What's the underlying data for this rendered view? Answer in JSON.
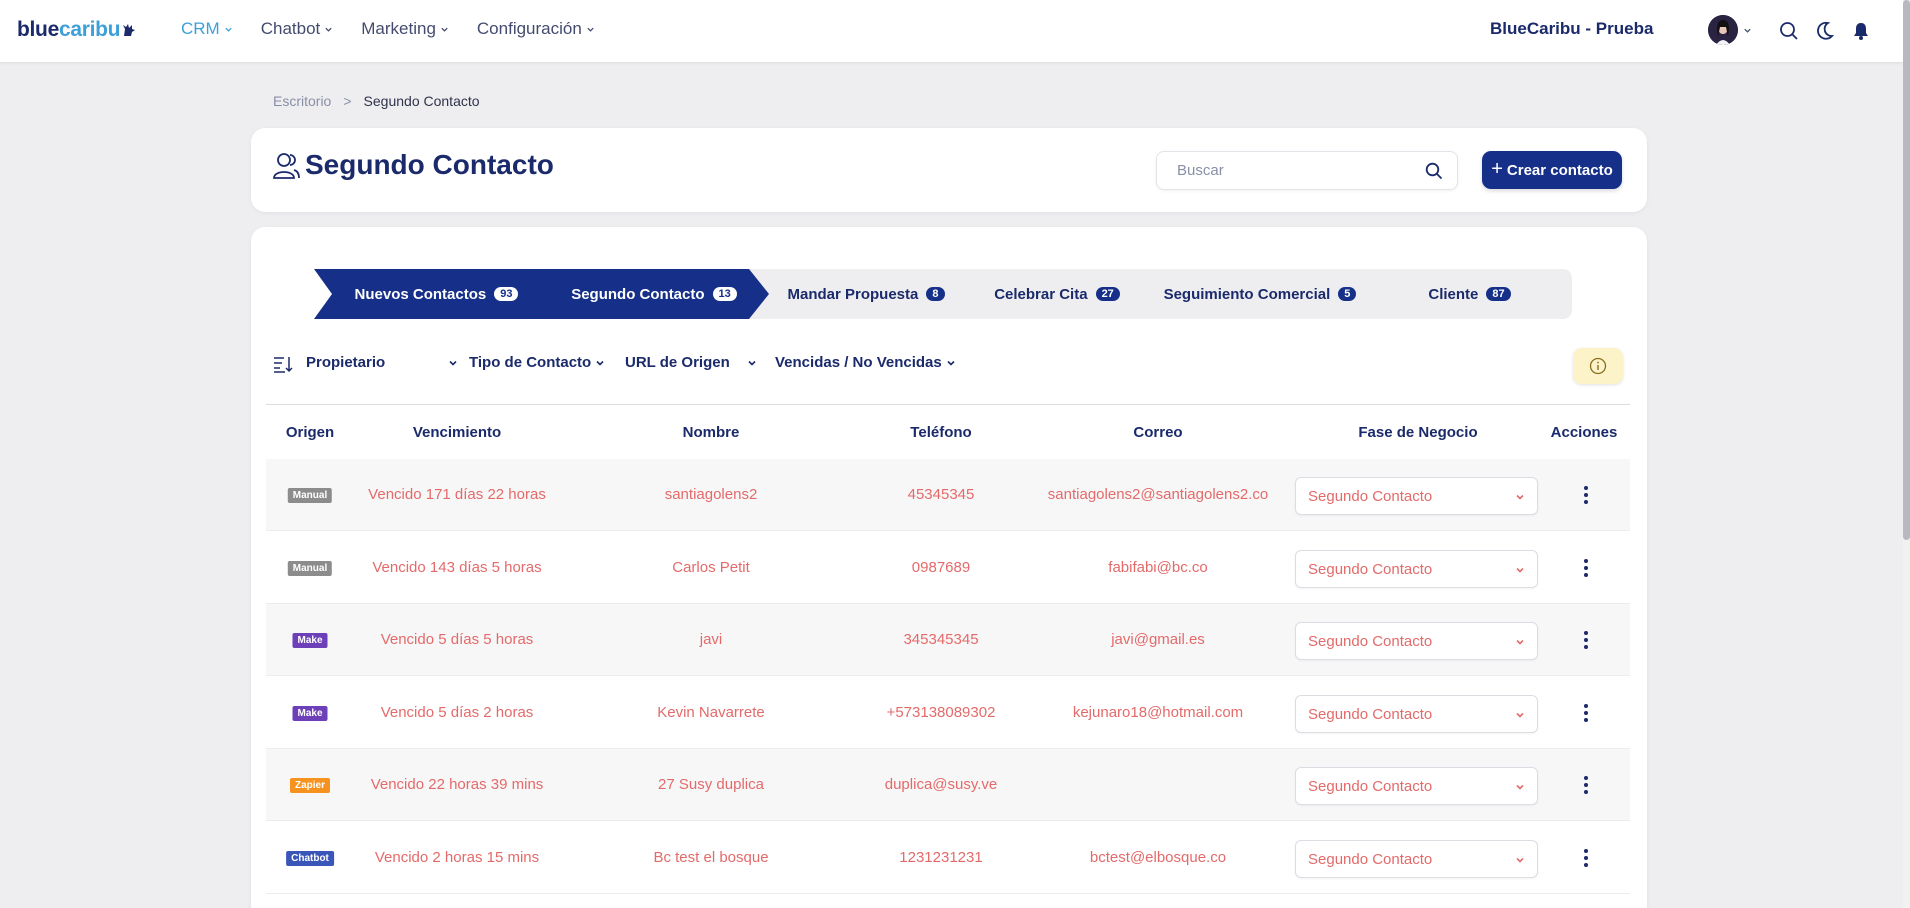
{
  "brand": {
    "logo_a": "blue",
    "logo_b": "caribu"
  },
  "nav": {
    "items": [
      {
        "label": "CRM",
        "active": true
      },
      {
        "label": "Chatbot",
        "active": false
      },
      {
        "label": "Marketing",
        "active": false
      },
      {
        "label": "Configuración",
        "active": false
      }
    ],
    "org_name": "BlueCaribu - Prueba"
  },
  "breadcrumb": {
    "root": "Escritorio",
    "separator": ">",
    "current": "Segundo Contacto"
  },
  "header": {
    "title": "Segundo Contacto",
    "search_placeholder": "Buscar",
    "create_label": "Crear contacto",
    "create_icon": "+"
  },
  "pipeline": [
    {
      "label": "Nuevos Contactos",
      "count": "93",
      "active": true
    },
    {
      "label": "Segundo Contacto",
      "count": "13",
      "active": true
    },
    {
      "label": "Mandar Propuesta",
      "count": "8",
      "active": false
    },
    {
      "label": "Celebrar Cita",
      "count": "27",
      "active": false
    },
    {
      "label": "Seguimiento Comercial",
      "count": "5",
      "active": false
    },
    {
      "label": "Cliente",
      "count": "87",
      "active": false
    }
  ],
  "filters": {
    "owner": "Propietario",
    "contact_type": "Tipo de Contacto",
    "origin_url": "URL de Origen",
    "expired": "Vencidas / No Vencidas"
  },
  "table": {
    "headers": {
      "origin": "Origen",
      "due": "Vencimiento",
      "name": "Nombre",
      "phone": "Teléfono",
      "email": "Correo",
      "stage": "Fase de Negocio",
      "actions": "Acciones"
    },
    "rows": [
      {
        "origin": "Manual",
        "origin_color": "#8c8c8c",
        "due": "Vencido 171 días 22 horas",
        "name": "santiagolens2",
        "phone": "45345345",
        "email": "santiagolens2@santiagolens2.co",
        "stage": "Segundo Contacto"
      },
      {
        "origin": "Manual",
        "origin_color": "#8c8c8c",
        "due": "Vencido 143 días 5 horas",
        "name": "Carlos Petit",
        "phone": "0987689",
        "email": "fabifabi@bc.co",
        "stage": "Segundo Contacto"
      },
      {
        "origin": "Make",
        "origin_color": "#6d3fb8",
        "due": "Vencido 5 días 5 horas",
        "name": "javi",
        "phone": "345345345",
        "email": "javi@gmail.es",
        "stage": "Segundo Contacto"
      },
      {
        "origin": "Make",
        "origin_color": "#6d3fb8",
        "due": "Vencido 5 días 2 horas",
        "name": "Kevin Navarrete",
        "phone": "+573138089302",
        "email": "kejunaro18@hotmail.com",
        "stage": "Segundo Contacto"
      },
      {
        "origin": "Zapier",
        "origin_color": "#f5931e",
        "due": "Vencido 22 horas 39 mins",
        "name": "27 Susy duplica",
        "phone": "duplica@susy.ve",
        "email": "",
        "stage": "Segundo Contacto"
      },
      {
        "origin": "Chatbot",
        "origin_color": "#3a56b8",
        "due": "Vencido 2 horas 15 mins",
        "name": "Bc test el bosque",
        "phone": "1231231231",
        "email": "bctest@elbosque.co",
        "stage": "Segundo Contacto"
      }
    ]
  },
  "colors": {
    "primary": "#16308a",
    "accent": "#3da0d8",
    "overdue_text": "#e46a6a",
    "info_bg": "#fdf3c9"
  }
}
